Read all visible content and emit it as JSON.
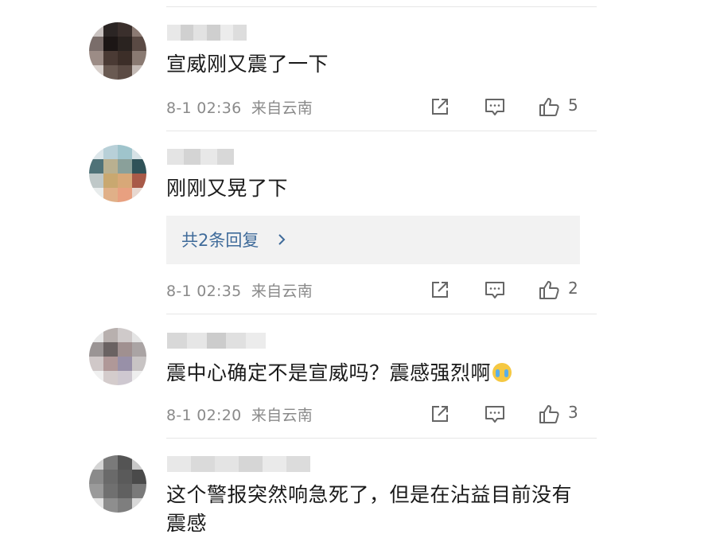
{
  "comments": [
    {
      "text": "宣威刚又震了一下",
      "time": "8-1 02:36",
      "location": "来自云南",
      "likes": "5",
      "avatar_colors": [
        "#c9c2c0",
        "#2b2524",
        "#3a2f2c",
        "#8b7a73",
        "#7a6d6a",
        "#1c1615",
        "#2a2320",
        "#5a4a44",
        "#9c8c86",
        "#4a3a34",
        "#3c2e28",
        "#8a7a72",
        "#d8d0cc",
        "#6a5a52",
        "#5b4b44",
        "#c4bab5"
      ],
      "name_colors": [
        "#e8e8e8",
        "#d0d0d0",
        "#e2e2e2",
        "#cfcfcf",
        "#ececec",
        "#dddddd"
      ]
    },
    {
      "text": "刚刚又晃了下",
      "time": "8-1 02:35",
      "location": "来自云南",
      "likes": "2",
      "replies_label": "共2条回复",
      "avatar_colors": [
        "#dce6ea",
        "#b8d0d8",
        "#9fc4cc",
        "#d6e2e6",
        "#4f7278",
        "#b9b090",
        "#8aa09a",
        "#2f5258",
        "#bfc8c8",
        "#c9a870",
        "#d8a878",
        "#a85a48",
        "#e8ecec",
        "#e0b088",
        "#e8a080",
        "#e8d8d0"
      ],
      "name_colors": [
        "#e4e4e4",
        "#d4d4d4",
        "#e8e8e8",
        "#d8d8d8"
      ]
    },
    {
      "text": "震中心确定不是宣威吗？震感强烈啊",
      "time": "8-1 02:20",
      "location": "来自云南",
      "likes": "3",
      "avatar_colors": [
        "#e8e8e8",
        "#b8b0ae",
        "#cfcaca",
        "#e4e4e4",
        "#9a9494",
        "#6a6262",
        "#a09090",
        "#aaa4a4",
        "#d0c8c8",
        "#b09898",
        "#9890a8",
        "#c8c4c4",
        "#f0f0f0",
        "#d4cccc",
        "#cec8d0",
        "#eeeeee"
      ],
      "name_colors": [
        "#d8d8d8",
        "#e6e6e6",
        "#cccccc",
        "#e0e0e0",
        "#ececec"
      ]
    },
    {
      "text": "这个警报突然响急死了，但是在沾益目前没有震感",
      "avatar_colors": [
        "#d4d4d4",
        "#7a7a7a",
        "#545454",
        "#c8c8c8",
        "#8a8a8a",
        "#6a6a6a",
        "#5a5a5a",
        "#4a4a4a",
        "#9a9a9a",
        "#707070",
        "#606060",
        "#7a7a7a",
        "#e4e4e4",
        "#8e8e8e",
        "#7e7e7e",
        "#d8d8d8"
      ],
      "name_colors": [
        "#e8e8e8",
        "#dadada",
        "#e4e4e4",
        "#d6d6d6",
        "#eaeaea",
        "#dcdcdc"
      ]
    }
  ],
  "icons": {
    "share": "share-icon",
    "comment": "comment-icon",
    "like": "like-icon",
    "chevron": "chevron-right-icon",
    "emoji": "crying-face-emoji"
  }
}
